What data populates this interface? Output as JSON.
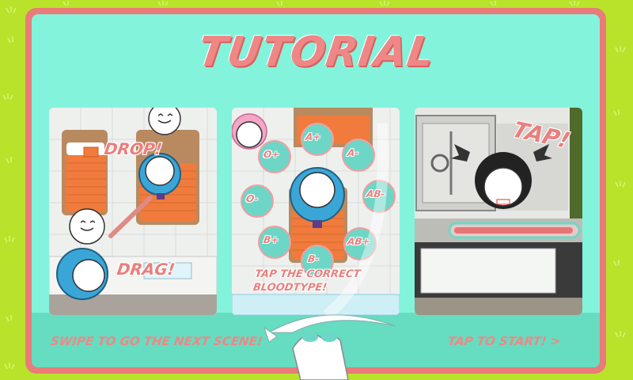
{
  "title": "TUTORIAL",
  "scenes": {
    "drag_drop": {
      "drop_label": "DROP!",
      "drag_label": "DRAG!"
    },
    "bloodtype": {
      "instruction_line1": "TAP THE CORRECT",
      "instruction_line2": "BLOODTYPE!",
      "types": [
        "A+",
        "A-",
        "O+",
        "O-",
        "AB-",
        "B+",
        "AB+",
        "B-"
      ]
    },
    "tap": {
      "tap_label": "TAP!"
    }
  },
  "footer": {
    "swipe_hint": "SWIPE TO GO THE NEXT SCENE!",
    "start_link": "TAP TO START! >"
  },
  "colors": {
    "background": "#b9e32a",
    "panel_border": "#e97b78",
    "panel_fill": "#84f3dc",
    "text_accent": "#ee8786",
    "character_blue": "#3aa6d8"
  }
}
